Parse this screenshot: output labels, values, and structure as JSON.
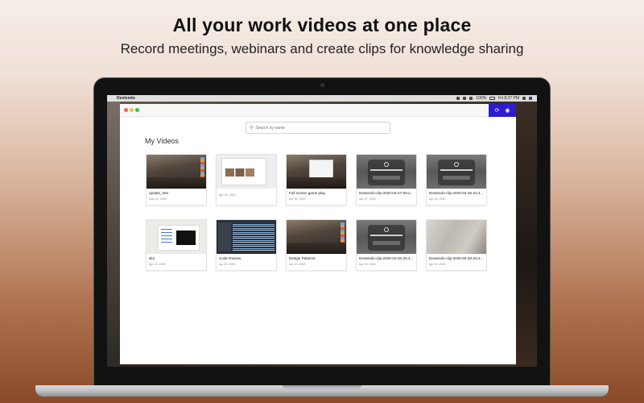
{
  "headline": "All your work videos at one place",
  "subline": "Record meetings, webinars and create clips for knowledge sharing",
  "menubar": {
    "app_name": "Devtendo",
    "battery": "100%",
    "clock": "Fri 8:27 PM"
  },
  "app": {
    "search_placeholder": "Search by name",
    "section_title": "My Videos",
    "actions": [
      {
        "icon": "refresh-icon",
        "glyph": "⟳"
      },
      {
        "icon": "profile-icon",
        "glyph": "◉"
      }
    ],
    "videos": [
      {
        "title": "update_test",
        "date": "May 01, 2020",
        "thumb": "desktop"
      },
      {
        "title": "",
        "date": "Apr 30, 2020",
        "thumb": "browser"
      },
      {
        "title": "Full screen game play",
        "date": "Apr 30, 2020",
        "thumb": "fullscreen"
      },
      {
        "title": "Devtendo-clip-2020-04-27-09.2...",
        "date": "Apr 27, 2020",
        "thumb": "broadcast"
      },
      {
        "title": "Devtendo-clip-2020-04-25-22.4...",
        "date": "Apr 25, 2020",
        "thumb": "broadcast"
      },
      {
        "title": "skit",
        "date": "Apr 20, 2020",
        "thumb": "office"
      },
      {
        "title": "Code Review",
        "date": "Apr 20, 2020",
        "thumb": "code"
      },
      {
        "title": "Design Patterns",
        "date": "Apr 20, 2020",
        "thumb": "desktop"
      },
      {
        "title": "Devtendo-clip-2020-04-20-20.4...",
        "date": "Apr 20, 2020",
        "thumb": "broadcast"
      },
      {
        "title": "Devtendo-clip-2020-04-20-20.4...",
        "date": "Apr 20, 2020",
        "thumb": "blur"
      }
    ]
  },
  "colors": {
    "accent": "#2c1dd1",
    "traffic_red": "#fe5f57",
    "traffic_yellow": "#febc2e",
    "traffic_green": "#28c840"
  }
}
